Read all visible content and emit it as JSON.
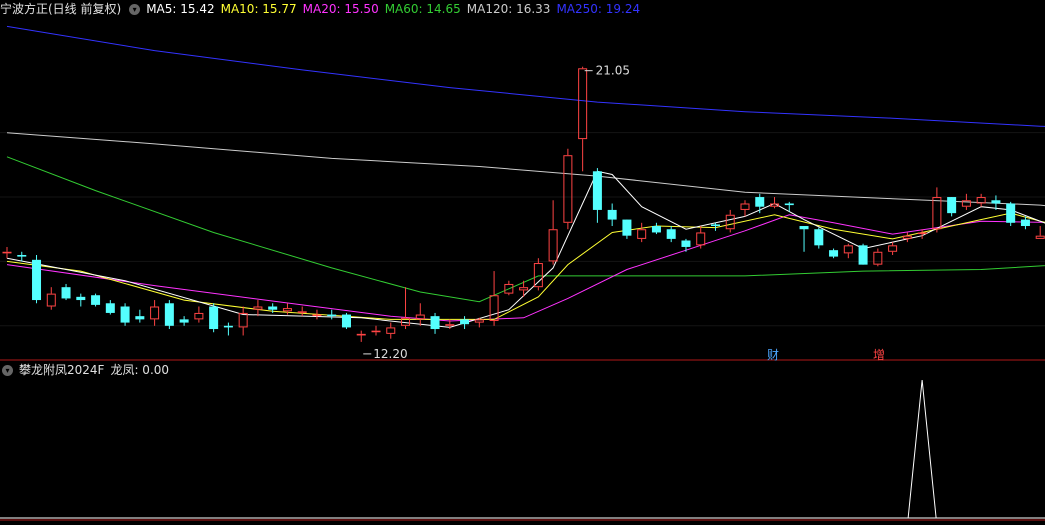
{
  "header": {
    "title": "宁波方正(日线 前复权)",
    "ma_items": [
      {
        "label": "MA5: 15.42",
        "color": "#ffffff"
      },
      {
        "label": "MA10: 15.77",
        "color": "#ffff33"
      },
      {
        "label": "MA20: 15.50",
        "color": "#ff33ff"
      },
      {
        "label": "MA60: 14.65",
        "color": "#33cc33"
      },
      {
        "label": "MA120: 16.33",
        "color": "#cccccc"
      },
      {
        "label": "MA250: 19.24",
        "color": "#3333ff"
      }
    ]
  },
  "indicator": {
    "title": "攀龙附凤2024F",
    "value_label": "龙凤: 0.00"
  },
  "markers": {
    "cai": "财",
    "zeng": "增"
  },
  "colors": {
    "up": "#ff4444",
    "down": "#54ffff",
    "ma5": "#ffffff",
    "ma10": "#ffff33",
    "ma20": "#ff33ff",
    "ma60": "#33cc33",
    "ma120": "#cccccc",
    "ma250": "#3333ff",
    "separator": "#b01818"
  },
  "chart_data": {
    "type": "candlestick",
    "price_range": [
      12.0,
      22.5
    ],
    "high_label": "21.05",
    "low_label": "12.20",
    "candles": [
      [
        15.25,
        15.3,
        15.45,
        15.1
      ],
      [
        15.2,
        15.15,
        15.3,
        15.0
      ],
      [
        15.05,
        13.8,
        15.2,
        13.7
      ],
      [
        13.6,
        14.0,
        14.2,
        13.5
      ],
      [
        14.2,
        13.85,
        14.3,
        13.8
      ],
      [
        13.9,
        13.8,
        14.0,
        13.6
      ],
      [
        13.95,
        13.65,
        14.0,
        13.6
      ],
      [
        13.7,
        13.4,
        13.8,
        13.35
      ],
      [
        13.6,
        13.1,
        13.7,
        13.0
      ],
      [
        13.3,
        13.2,
        13.5,
        13.1
      ],
      [
        13.2,
        13.6,
        13.8,
        13.0
      ],
      [
        13.7,
        13.0,
        13.8,
        12.9
      ],
      [
        13.2,
        13.1,
        13.3,
        13.0
      ],
      [
        13.2,
        13.4,
        13.6,
        13.1
      ],
      [
        13.6,
        12.9,
        13.7,
        12.8
      ],
      [
        13.0,
        12.95,
        13.1,
        12.7
      ],
      [
        12.95,
        13.4,
        13.6,
        12.7
      ],
      [
        13.5,
        13.6,
        13.8,
        13.3
      ],
      [
        13.6,
        13.5,
        13.7,
        13.4
      ],
      [
        13.45,
        13.55,
        13.7,
        13.35
      ],
      [
        13.4,
        13.45,
        13.6,
        13.3
      ],
      [
        13.35,
        13.35,
        13.5,
        13.2
      ],
      [
        13.35,
        13.3,
        13.5,
        13.2
      ],
      [
        13.35,
        12.95,
        13.4,
        12.9
      ],
      [
        12.7,
        12.75,
        12.85,
        12.5
      ],
      [
        12.8,
        12.85,
        13.0,
        12.7
      ],
      [
        12.75,
        12.95,
        13.1,
        12.6
      ],
      [
        13.0,
        13.25,
        14.2,
        12.9
      ],
      [
        13.2,
        13.35,
        13.7,
        13.0
      ],
      [
        13.3,
        12.9,
        13.4,
        12.75
      ],
      [
        13.0,
        13.05,
        13.2,
        12.9
      ],
      [
        13.2,
        13.05,
        13.3,
        12.9
      ],
      [
        13.1,
        13.2,
        13.25,
        12.95
      ],
      [
        13.15,
        13.95,
        14.7,
        13.0
      ],
      [
        14.0,
        14.3,
        14.4,
        13.95
      ],
      [
        14.1,
        14.2,
        14.4,
        13.9
      ],
      [
        14.2,
        14.95,
        15.1,
        14.1
      ],
      [
        15.0,
        16.0,
        16.9,
        14.9
      ],
      [
        16.2,
        18.3,
        18.5,
        16.0
      ],
      [
        18.8,
        21.0,
        21.05,
        17.8
      ],
      [
        17.8,
        16.6,
        17.9,
        16.2
      ],
      [
        16.6,
        16.3,
        16.8,
        16.1
      ],
      [
        16.3,
        15.8,
        16.3,
        15.7
      ],
      [
        15.7,
        16.0,
        16.2,
        15.6
      ],
      [
        16.1,
        15.9,
        16.2,
        15.85
      ],
      [
        16.0,
        15.7,
        16.1,
        15.6
      ],
      [
        15.65,
        15.45,
        15.7,
        15.3
      ],
      [
        15.5,
        15.9,
        16.1,
        15.4
      ],
      [
        16.15,
        16.1,
        16.2,
        15.95
      ],
      [
        16.0,
        16.45,
        16.6,
        15.9
      ],
      [
        16.6,
        16.8,
        16.9,
        16.4
      ],
      [
        17.0,
        16.7,
        17.1,
        16.5
      ],
      [
        16.7,
        16.8,
        17.0,
        16.65
      ],
      [
        16.8,
        16.75,
        16.85,
        16.55
      ],
      [
        16.1,
        16.0,
        16.1,
        15.3
      ],
      [
        16.0,
        15.5,
        16.05,
        15.4
      ],
      [
        15.35,
        15.15,
        15.4,
        15.1
      ],
      [
        15.25,
        15.5,
        15.55,
        15.1
      ],
      [
        15.5,
        14.9,
        15.55,
        14.9
      ],
      [
        14.9,
        15.3,
        15.4,
        14.85
      ],
      [
        15.3,
        15.5,
        15.6,
        15.2
      ],
      [
        15.7,
        15.8,
        15.9,
        15.6
      ],
      [
        15.85,
        15.9,
        16.0,
        15.7
      ],
      [
        16.0,
        17.0,
        17.3,
        15.9
      ],
      [
        17.0,
        16.5,
        17.0,
        16.4
      ],
      [
        16.7,
        16.9,
        17.1,
        16.6
      ],
      [
        16.8,
        17.0,
        17.1,
        16.7
      ],
      [
        16.9,
        16.8,
        17.05,
        16.6
      ],
      [
        16.8,
        16.2,
        16.85,
        16.1
      ],
      [
        16.3,
        16.1,
        16.4,
        16.0
      ],
      [
        15.7,
        15.8,
        16.1,
        15.7
      ],
      [
        16.1,
        15.5,
        16.2,
        15.4
      ],
      [
        15.5,
        16.0,
        16.2,
        15.5
      ],
      [
        15.9,
        16.05,
        16.1,
        15.8
      ],
      [
        16.05,
        16.0,
        16.25,
        15.9
      ],
      [
        16.4,
        15.5,
        16.5,
        15.4
      ]
    ],
    "ma_lines": {
      "ma5": [
        [
          0,
          15.1
        ],
        [
          8,
          14.4
        ],
        [
          16,
          13.35
        ],
        [
          24,
          13.25
        ],
        [
          30,
          12.95
        ],
        [
          34,
          13.5
        ],
        [
          37,
          14.8
        ],
        [
          39,
          16.8
        ],
        [
          40,
          17.8
        ],
        [
          41,
          17.7
        ],
        [
          43,
          16.7
        ],
        [
          46,
          16.0
        ],
        [
          50,
          16.4
        ],
        [
          52,
          16.8
        ],
        [
          54,
          16.3
        ],
        [
          58,
          15.4
        ],
        [
          62,
          15.8
        ],
        [
          66,
          16.7
        ],
        [
          68,
          16.6
        ],
        [
          72,
          15.9
        ],
        [
          75,
          15.6
        ]
      ],
      "ma10": [
        [
          0,
          15.0
        ],
        [
          5,
          14.7
        ],
        [
          12,
          13.8
        ],
        [
          18,
          13.45
        ],
        [
          26,
          13.2
        ],
        [
          33,
          13.2
        ],
        [
          36,
          13.9
        ],
        [
          38,
          14.9
        ],
        [
          41,
          15.9
        ],
        [
          44,
          16.1
        ],
        [
          48,
          16.05
        ],
        [
          52,
          16.45
        ],
        [
          56,
          16.0
        ],
        [
          60,
          15.7
        ],
        [
          64,
          16.1
        ],
        [
          68,
          16.5
        ],
        [
          70,
          16.25
        ],
        [
          75,
          15.77
        ]
      ],
      "ma20": [
        [
          0,
          14.9
        ],
        [
          10,
          14.25
        ],
        [
          20,
          13.65
        ],
        [
          26,
          13.3
        ],
        [
          30,
          13.15
        ],
        [
          35,
          13.25
        ],
        [
          38,
          13.85
        ],
        [
          42,
          14.75
        ],
        [
          46,
          15.35
        ],
        [
          50,
          15.95
        ],
        [
          53,
          16.45
        ],
        [
          56,
          16.2
        ],
        [
          60,
          15.85
        ],
        [
          66,
          16.25
        ],
        [
          72,
          16.2
        ],
        [
          75,
          15.5
        ]
      ],
      "ma60": [
        [
          0,
          18.25
        ],
        [
          6,
          17.2
        ],
        [
          14,
          15.9
        ],
        [
          22,
          14.8
        ],
        [
          28,
          14.05
        ],
        [
          32,
          13.75
        ],
        [
          36,
          14.55
        ],
        [
          40,
          14.55
        ],
        [
          50,
          14.55
        ],
        [
          58,
          14.7
        ],
        [
          66,
          14.75
        ],
        [
          75,
          15.0
        ]
      ],
      "ma120": [
        [
          0,
          19.0
        ],
        [
          10,
          18.65
        ],
        [
          22,
          18.2
        ],
        [
          32,
          17.95
        ],
        [
          40,
          17.65
        ],
        [
          50,
          17.15
        ],
        [
          60,
          16.95
        ],
        [
          70,
          16.75
        ],
        [
          75,
          16.5
        ]
      ],
      "ma250": [
        [
          0,
          22.3
        ],
        [
          10,
          21.55
        ],
        [
          20,
          20.95
        ],
        [
          30,
          20.4
        ],
        [
          40,
          19.95
        ],
        [
          50,
          19.65
        ],
        [
          60,
          19.45
        ],
        [
          70,
          19.2
        ],
        [
          75,
          19.1
        ]
      ]
    },
    "indicator_series": {
      "name": "龙凤",
      "spike_index": 62,
      "spike_value": 1,
      "current": 0.0
    }
  }
}
